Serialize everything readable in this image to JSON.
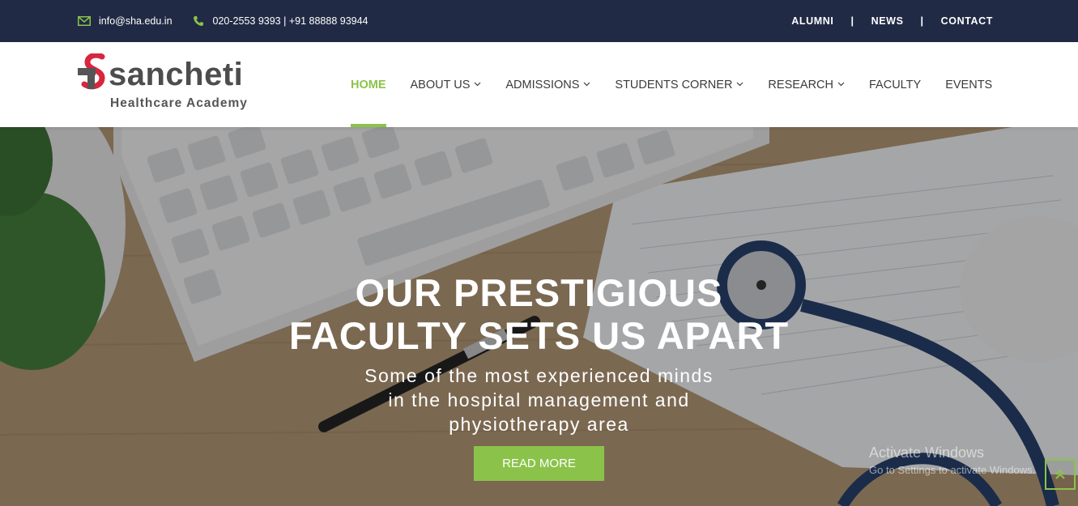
{
  "topbar": {
    "email": "info@sha.edu.in",
    "phone": "020-2553 9393 | +91 88888 93944",
    "email_icon": "envelope-icon",
    "phone_icon": "phone-icon",
    "links": [
      "ALUMNI",
      "NEWS",
      "CONTACT"
    ],
    "separator": "|"
  },
  "logo": {
    "brand": "sancheti",
    "tagline": "Healthcare Academy"
  },
  "nav": {
    "items": [
      {
        "label": "HOME",
        "active": true
      },
      {
        "label": "ABOUT US",
        "dropdown": true
      },
      {
        "label": "ADMISSIONS",
        "dropdown": true
      },
      {
        "label": "STUDENTS CORNER",
        "dropdown": true
      },
      {
        "label": "RESEARCH",
        "dropdown": true
      },
      {
        "label": "FACULTY"
      },
      {
        "label": "EVENTS"
      }
    ],
    "chevron": "⌄"
  },
  "hero": {
    "title_line1": "OUR PRESTIGIOUS",
    "title_line2": "FACULTY SETS US APART",
    "sub_line1": "Some of the most experienced minds",
    "sub_line2": "in the hospital management and",
    "sub_line3": "physiotherapy area",
    "button": "READ MORE"
  },
  "watermark": {
    "line1": "Activate Windows",
    "line2": "Go to Settings to activate Windows."
  },
  "scroll_top_icon": "double-chevron-up-icon",
  "colors": {
    "topbar_bg": "#212a45",
    "accent": "#8bc34a",
    "nav_text": "#3b3b3b"
  }
}
